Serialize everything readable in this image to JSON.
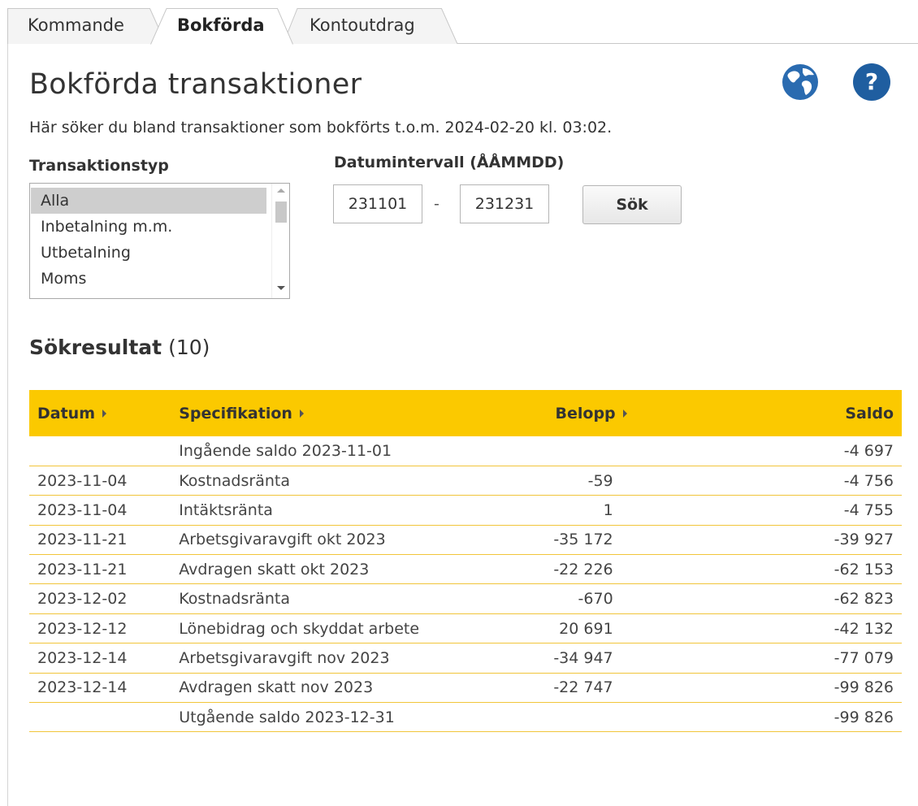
{
  "tabs": [
    {
      "label": "Kommande"
    },
    {
      "label": "Bokförda"
    },
    {
      "label": "Kontoutdrag"
    }
  ],
  "active_tab": "Bokförda",
  "page": {
    "title": "Bokförda transaktioner",
    "subtitle": "Här söker du bland transaktioner som bokförts t.o.m. 2024-02-20 kl. 03:02.",
    "icons": {
      "globe": "globe-icon",
      "help": "help-icon",
      "help_glyph": "?"
    }
  },
  "filters": {
    "type_label": "Transaktionstyp",
    "type_options": [
      "Alla",
      "Inbetalning m.m.",
      "Utbetalning",
      "Moms"
    ],
    "selected_type": "Alla",
    "date_label": "Datumintervall (ÅÅMMDD)",
    "date_from": "231101",
    "date_to": "231231",
    "date_separator": "-",
    "search_label": "Sök"
  },
  "results": {
    "title": "Sökresultat",
    "count": "(10)",
    "columns": [
      "Datum",
      "Specifikation",
      "Belopp",
      "Saldo"
    ],
    "rows": [
      {
        "datum": "",
        "spec": "Ingående saldo 2023-11-01",
        "belopp": "",
        "saldo": "-4 697"
      },
      {
        "datum": "2023-11-04",
        "spec": "Kostnadsränta",
        "belopp": "-59",
        "saldo": "-4 756"
      },
      {
        "datum": "2023-11-04",
        "spec": "Intäktsränta",
        "belopp": "1",
        "saldo": "-4 755"
      },
      {
        "datum": "2023-11-21",
        "spec": "Arbetsgivaravgift okt 2023",
        "belopp": "-35 172",
        "saldo": "-39 927"
      },
      {
        "datum": "2023-11-21",
        "spec": "Avdragen skatt okt 2023",
        "belopp": "-22 226",
        "saldo": "-62 153"
      },
      {
        "datum": "2023-12-02",
        "spec": "Kostnadsränta",
        "belopp": "-670",
        "saldo": "-62 823"
      },
      {
        "datum": "2023-12-12",
        "spec": "Lönebidrag och skyddat arbete",
        "belopp": "20 691",
        "saldo": "-42 132"
      },
      {
        "datum": "2023-12-14",
        "spec": "Arbetsgivaravgift nov 2023",
        "belopp": "-34 947",
        "saldo": "-77 079"
      },
      {
        "datum": "2023-12-14",
        "spec": "Avdragen skatt nov 2023",
        "belopp": "-22 747",
        "saldo": "-99 826"
      },
      {
        "datum": "",
        "spec": "Utgående saldo 2023-12-31",
        "belopp": "",
        "saldo": "-99 826"
      }
    ]
  },
  "colors": {
    "header_bg": "#fbc900",
    "row_border": "#f1c53a",
    "help_bg": "#1f5ea0"
  }
}
